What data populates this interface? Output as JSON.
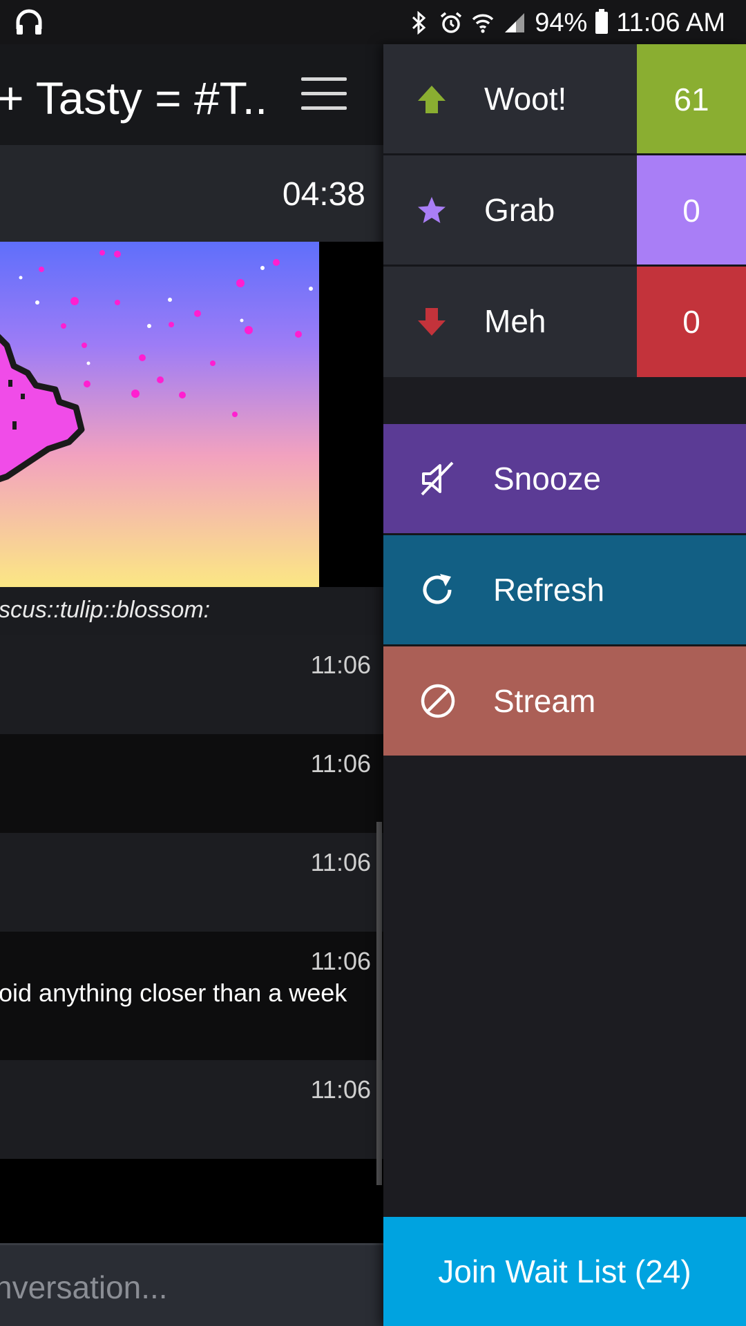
{
  "status_bar": {
    "battery": "94%",
    "time": "11:06 AM"
  },
  "chat": {
    "room_title": "+ Tasty = #T..",
    "track_time_remaining": "04:38",
    "last_message_fragment": "scus::tulip::blossom:",
    "messages": [
      {
        "time": "11:06",
        "text": ""
      },
      {
        "time": "11:06",
        "text": ""
      },
      {
        "time": "11:06",
        "text": ""
      },
      {
        "time": "11:06",
        "text": "oid anything closer than a week"
      },
      {
        "time": "11:06",
        "text": ""
      }
    ],
    "input_placeholder": "nversation..."
  },
  "drawer": {
    "votes": [
      {
        "label": "Woot!",
        "count": "61",
        "icon": "arrow-up-icon",
        "color": "#8aae31"
      },
      {
        "label": "Grab",
        "count": "0",
        "icon": "star-icon",
        "color": "#a97ef6"
      },
      {
        "label": "Meh",
        "count": "0",
        "icon": "arrow-down-icon",
        "color": "#c3333b"
      }
    ],
    "actions": [
      {
        "label": "Snooze",
        "icon": "mute-icon",
        "color": "#5b3b95"
      },
      {
        "label": "Refresh",
        "icon": "refresh-icon",
        "color": "#125f84"
      },
      {
        "label": "Stream",
        "icon": "no-stream-icon",
        "color": "#ab5f56"
      }
    ],
    "join_label": "Join Wait List (24)",
    "join_color": "#00a3e0"
  }
}
